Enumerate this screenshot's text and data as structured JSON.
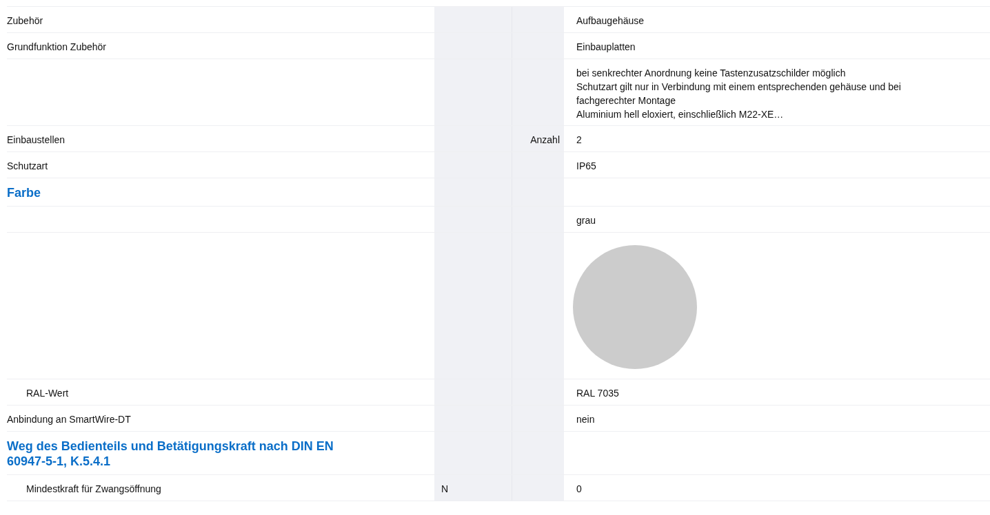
{
  "rows": [
    {
      "kind": "field",
      "label": "Zubehör",
      "value": "Aufbaugehäuse"
    },
    {
      "kind": "field",
      "label": "Grundfunktion Zubehör",
      "value": "Einbauplatten"
    },
    {
      "kind": "notes",
      "lines": [
        "bei senkrechter Anordnung keine Tastenzusatzschilder möglich",
        "Schutzart gilt nur in Verbindung mit einem entsprechenden gehäuse und bei fachgerechter Montage",
        "Aluminium hell eloxiert, einschließlich M22-XE…"
      ]
    },
    {
      "kind": "field",
      "label": "Einbaustellen",
      "qualifier": "Anzahl",
      "value": "2"
    },
    {
      "kind": "field",
      "label": "Schutzart",
      "value": "IP65"
    },
    {
      "kind": "heading",
      "label": "Farbe",
      "children": [
        {
          "kind": "field",
          "value": "grau"
        },
        {
          "kind": "swatch",
          "color": "#cccccc"
        },
        {
          "kind": "field",
          "label": "RAL-Wert",
          "value": "RAL 7035"
        }
      ]
    },
    {
      "kind": "field",
      "label": "Anbindung an SmartWire-DT",
      "value": "nein"
    },
    {
      "kind": "heading",
      "label": "Weg des Bedienteils und Betätigungskraft nach DIN EN 60947-5-1, K.5.4.1",
      "children": [
        {
          "kind": "field",
          "label": "Mindestkraft für Zwangsöffnung",
          "unit": "N",
          "value": "0"
        }
      ]
    }
  ]
}
